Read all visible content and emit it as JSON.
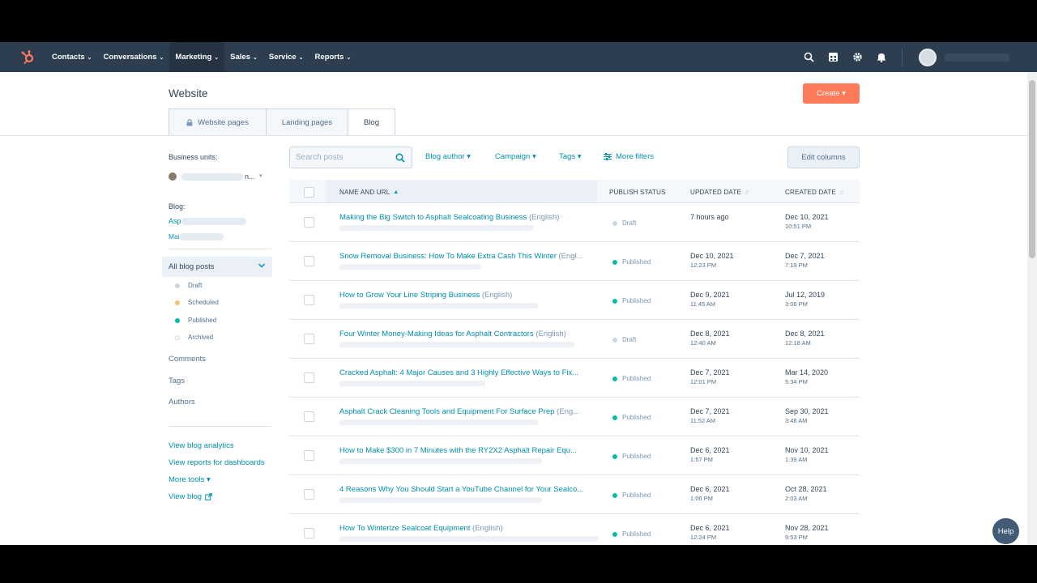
{
  "nav": {
    "items": [
      {
        "label": "Contacts"
      },
      {
        "label": "Conversations"
      },
      {
        "label": "Marketing"
      },
      {
        "label": "Sales"
      },
      {
        "label": "Service"
      },
      {
        "label": "Reports"
      }
    ],
    "active_index": 2
  },
  "page": {
    "title": "Website",
    "create_label": "Create ▾",
    "tabs": [
      "Website pages",
      "Landing pages",
      "Blog"
    ],
    "active_tab": "Blog"
  },
  "sidebar": {
    "business_units_label": "Business units:",
    "business_unit_value": "n...",
    "blog_label": "Blog:",
    "blog_link_1": "Asp",
    "blog_link_2": "Mai",
    "all_posts_label": "All blog posts",
    "statuses": [
      {
        "label": "Draft",
        "color": "#cbd6e2"
      },
      {
        "label": "Scheduled",
        "color": "#f5c26b"
      },
      {
        "label": "Published",
        "color": "#00bda5"
      },
      {
        "label": "Archived",
        "color": "#ffffff"
      }
    ],
    "sections": [
      "Comments",
      "Tags",
      "Authors"
    ],
    "links": {
      "analytics": "View blog analytics",
      "reports": "View reports for dashboards",
      "more_tools": "More tools ▾",
      "view_blog": "View blog"
    }
  },
  "filters": {
    "search_placeholder": "Search posts",
    "blog_author": "Blog author ▾",
    "campaign": "Campaign ▾",
    "tags": "Tags ▾",
    "more_filters": "More filters",
    "edit_columns": "Edit columns"
  },
  "table": {
    "headers": {
      "name": "NAME AND URL",
      "status": "PUBLISH STATUS",
      "updated": "UPDATED DATE",
      "created": "CREATED DATE"
    },
    "rows": [
      {
        "title": "Making the Big Switch to Asphalt Sealcoating Business",
        "lang": "(English)",
        "status": "Draft",
        "status_color": "#cbd6e2",
        "updated": "7 hours ago",
        "updated_time": "",
        "created": "Dec 10, 2021",
        "created_time": "10:51 PM"
      },
      {
        "title": "Snow Removal Business: How To Make Extra Cash This Winter",
        "lang": "(Engl...",
        "status": "Published",
        "status_color": "#00bda5",
        "updated": "Dec 10, 2021",
        "updated_time": "12:23 PM",
        "created": "Dec 7, 2021",
        "created_time": "7:19 PM"
      },
      {
        "title": "How to Grow Your Line Striping Business",
        "lang": "(English)",
        "status": "Published",
        "status_color": "#00bda5",
        "updated": "Dec 9, 2021",
        "updated_time": "11:45 AM",
        "created": "Jul 12, 2019",
        "created_time": "3:06 PM"
      },
      {
        "title": "Four Winter Money-Making Ideas for Asphalt Contractors",
        "lang": "(English)",
        "status": "Draft",
        "status_color": "#cbd6e2",
        "updated": "Dec 8, 2021",
        "updated_time": "12:40 AM",
        "created": "Dec 8, 2021",
        "created_time": "12:18 AM"
      },
      {
        "title": "Cracked Asphalt: 4 Major Causes and 3 Highly Effective Ways to Fix...",
        "lang": "",
        "status": "Published",
        "status_color": "#00bda5",
        "updated": "Dec 7, 2021",
        "updated_time": "12:01 PM",
        "created": "Mar 14, 2020",
        "created_time": "5:34 PM"
      },
      {
        "title": "Asphalt Crack Cleaning Tools and Equipment For Surface Prep",
        "lang": "(Eng...",
        "status": "Published",
        "status_color": "#00bda5",
        "updated": "Dec 7, 2021",
        "updated_time": "11:52 AM",
        "created": "Sep 30, 2021",
        "created_time": "3:48 AM"
      },
      {
        "title": "How to Make $300 in 7 Minutes with the RY2X2 Asphalt Repair Equ...",
        "lang": "",
        "status": "Published",
        "status_color": "#00bda5",
        "updated": "Dec 6, 2021",
        "updated_time": "1:57 PM",
        "created": "Nov 10, 2021",
        "created_time": "1:39 AM"
      },
      {
        "title": "4 Reasons Why You Should Start a YouTube Channel for Your Sealco...",
        "lang": "",
        "status": "Published",
        "status_color": "#00bda5",
        "updated": "Dec 6, 2021",
        "updated_time": "1:06 PM",
        "created": "Oct 28, 2021",
        "created_time": "2:03 AM"
      },
      {
        "title": "How To Winterize Sealcoat Equipment",
        "lang": "(English)",
        "status": "Published",
        "status_color": "#00bda5",
        "updated": "Dec 6, 2021",
        "updated_time": "12:24 PM",
        "created": "Nov 28, 2021",
        "created_time": "9:53 PM"
      }
    ]
  },
  "help_label": "Help",
  "colors": {
    "nav_bg": "#2d3e50",
    "accent": "#ff7a59",
    "link": "#0091ae",
    "published": "#00bda5"
  }
}
